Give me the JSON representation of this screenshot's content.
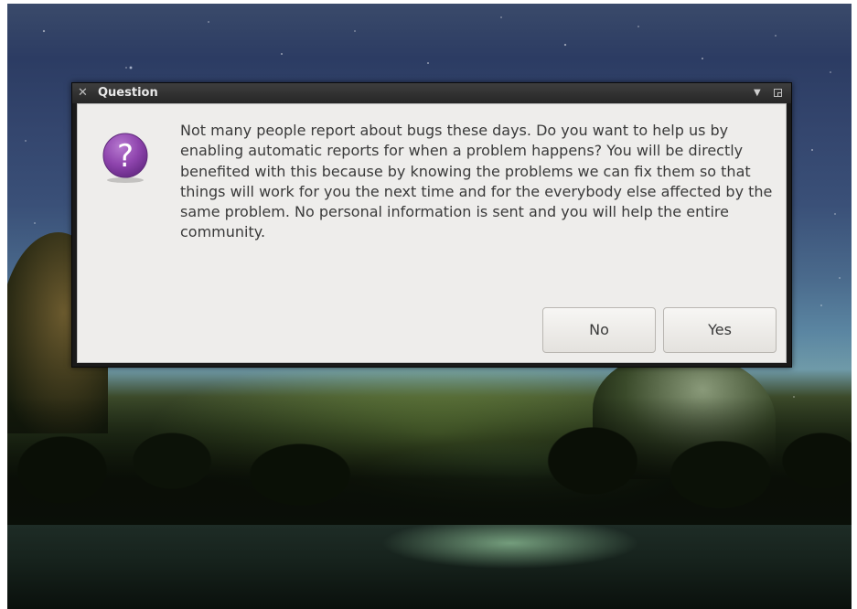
{
  "window": {
    "title": "Question",
    "close_glyph": "✕",
    "menu_glyph": "▼"
  },
  "dialog": {
    "icon": "question-icon",
    "icon_glyph": "?",
    "icon_color": "#8e44ad",
    "message": "Not many people report about bugs these days. Do you want to help us by enabling automatic reports for when a problem happens? You will be directly benefited with this because by knowing the problems we can fix them so that things will work for you the next time and for the everybody else affected by the same problem. No personal information is sent and you will help the entire community."
  },
  "buttons": {
    "no_label": "No",
    "yes_label": "Yes"
  }
}
